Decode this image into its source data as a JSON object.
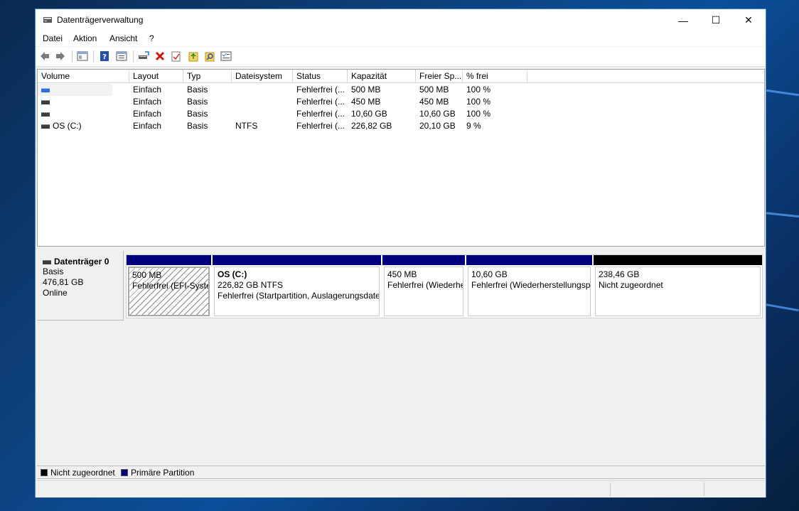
{
  "window": {
    "title": "Datenträgerverwaltung",
    "controls": {
      "minimize": "—",
      "maximize": "☐",
      "close": "✕"
    }
  },
  "menu": [
    {
      "label": "Datei"
    },
    {
      "label": "Aktion"
    },
    {
      "label": "Ansicht"
    },
    {
      "label": "?"
    }
  ],
  "toolbar": {
    "icons": [
      "back-icon",
      "forward-icon",
      "show-hide-console-tree-icon",
      "help-icon",
      "properties-icon",
      "connect-disk-icon",
      "delete-icon",
      "check-icon",
      "export-folder-icon",
      "search-folder-icon",
      "options-icon"
    ]
  },
  "volume_list": {
    "columns": [
      "Volume",
      "Layout",
      "Typ",
      "Dateisystem",
      "Status",
      "Kapazität",
      "Freier Sp...",
      "% frei"
    ],
    "rows": [
      {
        "volume": "",
        "layout": "Einfach",
        "typ": "Basis",
        "dateisystem": "",
        "status": "Fehlerfrei (...",
        "kapazitaet": "500 MB",
        "frei": "500 MB",
        "prozent": "100 %",
        "icon": "blue"
      },
      {
        "volume": "",
        "layout": "Einfach",
        "typ": "Basis",
        "dateisystem": "",
        "status": "Fehlerfrei (...",
        "kapazitaet": "450 MB",
        "frei": "450 MB",
        "prozent": "100 %",
        "icon": "gray"
      },
      {
        "volume": "",
        "layout": "Einfach",
        "typ": "Basis",
        "dateisystem": "",
        "status": "Fehlerfrei (...",
        "kapazitaet": "10,60 GB",
        "frei": "10,60 GB",
        "prozent": "100 %",
        "icon": "gray"
      },
      {
        "volume": "OS (C:)",
        "layout": "Einfach",
        "typ": "Basis",
        "dateisystem": "NTFS",
        "status": "Fehlerfrei (...",
        "kapazitaet": "226,82 GB",
        "frei": "20,10 GB",
        "prozent": "9 %",
        "icon": "gray"
      }
    ]
  },
  "disk": {
    "name": "Datenträger 0",
    "type": "Basis",
    "size": "476,81 GB",
    "state": "Online",
    "partitions": [
      {
        "title": "",
        "line1": "500 MB",
        "line2": "Fehlerfrei (EFI-Systempartition)",
        "bar_color": "#00007f",
        "hatched": true
      },
      {
        "title": "OS  (C:)",
        "line1": "226,82 GB NTFS",
        "line2": "Fehlerfrei (Startpartition, Auslagerungsdatei, Absturzabbild, Primäre Partition)",
        "bar_color": "#00007f",
        "hatched": false
      },
      {
        "title": "",
        "line1": "450 MB",
        "line2": "Fehlerfrei (Wiederherstellungspartition)",
        "bar_color": "#00007f",
        "hatched": false
      },
      {
        "title": "",
        "line1": "10,60 GB",
        "line2": "Fehlerfrei (Wiederherstellungspartition)",
        "bar_color": "#00007f",
        "hatched": false
      },
      {
        "title": "",
        "line1": "238,46 GB",
        "line2": "Nicht zugeordnet",
        "bar_color": "#000000",
        "hatched": false
      }
    ]
  },
  "legend": [
    {
      "label": "Nicht zugeordnet",
      "color": "#000000"
    },
    {
      "label": "Primäre Partition",
      "color": "#00007f"
    }
  ]
}
